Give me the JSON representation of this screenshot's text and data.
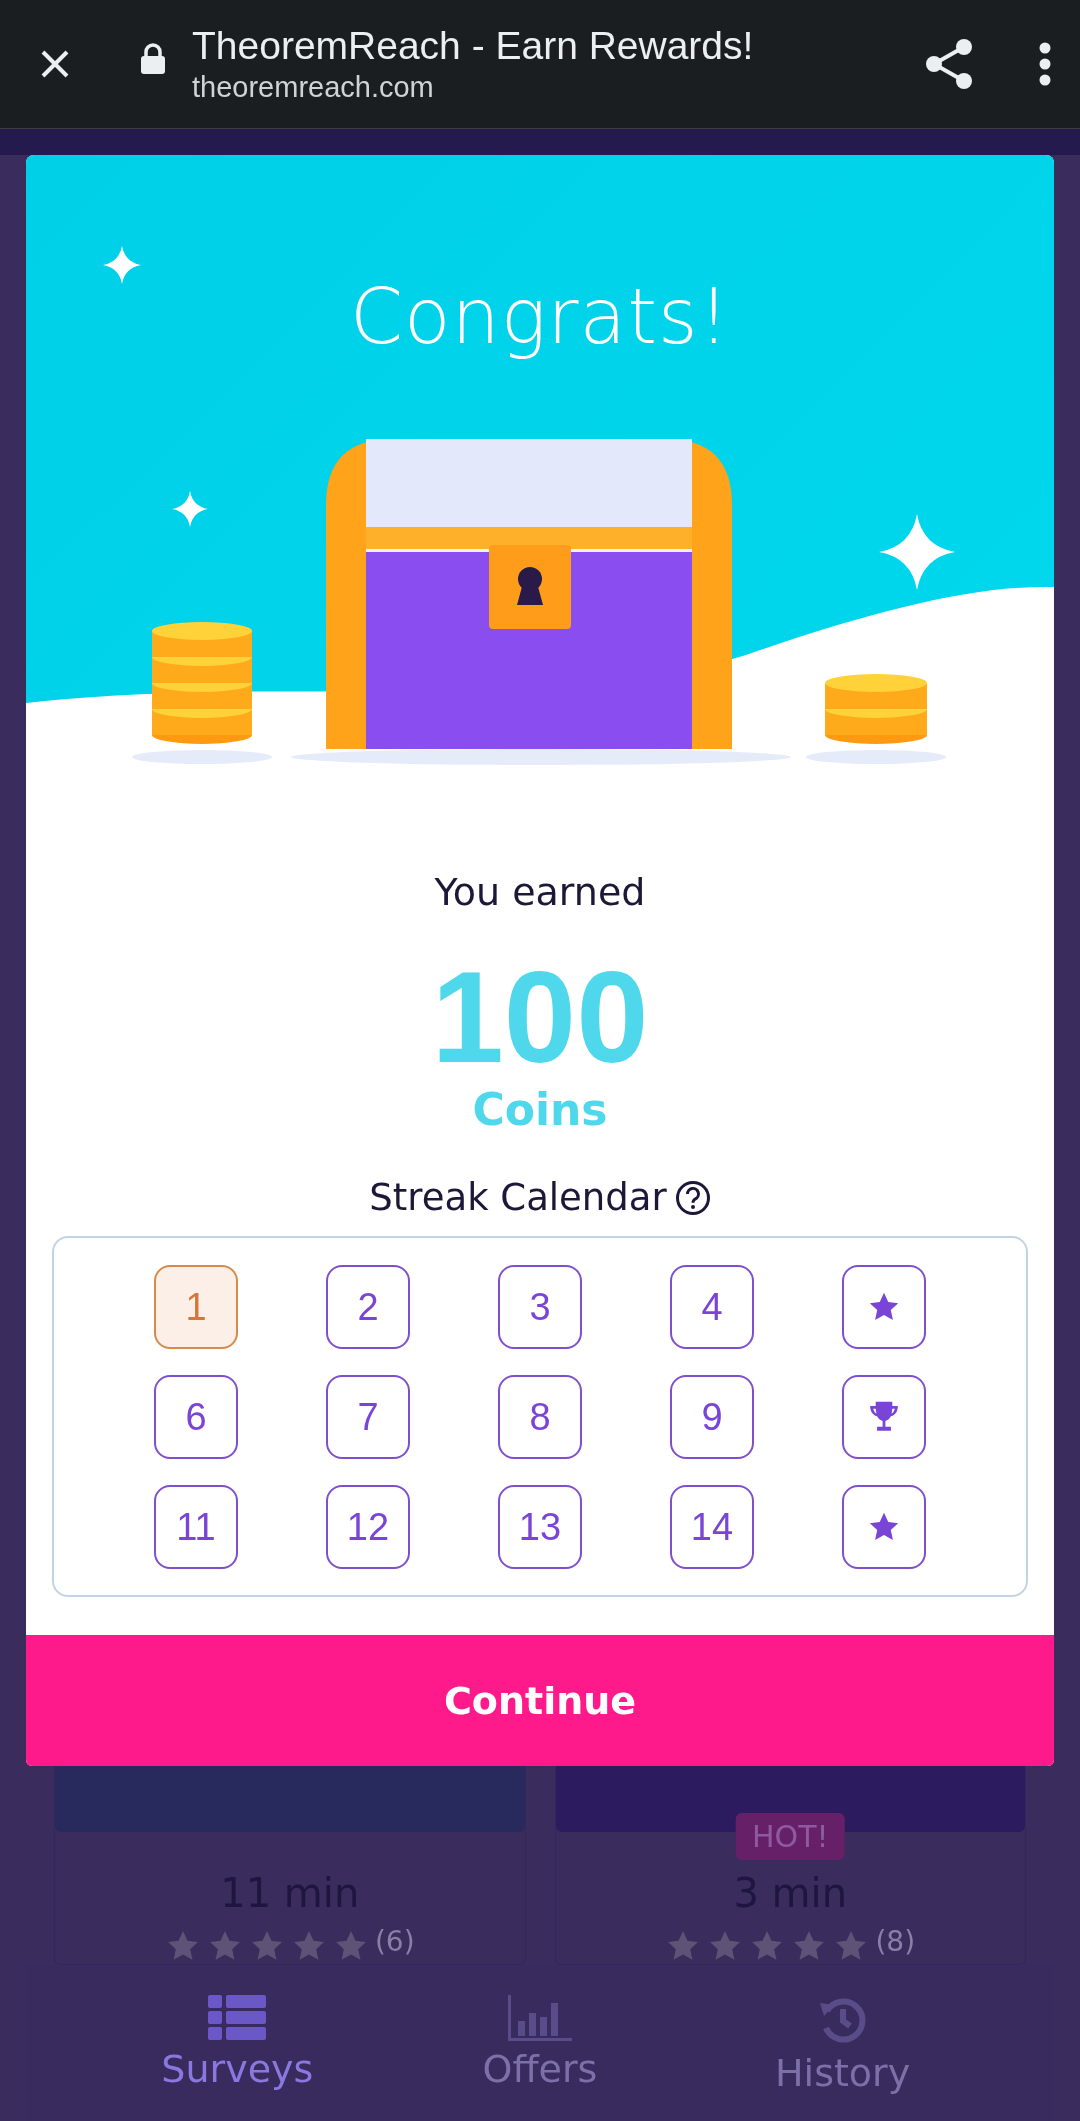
{
  "browser": {
    "title": "TheoremReach - Earn Rewards!",
    "url": "theoremreach.com"
  },
  "modal": {
    "heading": "Congrats!",
    "earned_label": "You earned",
    "amount": "100",
    "unit": "Coins",
    "calendar_title": "Streak Calendar",
    "days": [
      {
        "kind": "number",
        "label": "1",
        "selected": true
      },
      {
        "kind": "number",
        "label": "2",
        "selected": false
      },
      {
        "kind": "number",
        "label": "3",
        "selected": false
      },
      {
        "kind": "number",
        "label": "4",
        "selected": false
      },
      {
        "kind": "star",
        "selected": false
      },
      {
        "kind": "number",
        "label": "6",
        "selected": false
      },
      {
        "kind": "number",
        "label": "7",
        "selected": false
      },
      {
        "kind": "number",
        "label": "8",
        "selected": false
      },
      {
        "kind": "number",
        "label": "9",
        "selected": false
      },
      {
        "kind": "trophy",
        "selected": false
      },
      {
        "kind": "number",
        "label": "11",
        "selected": false
      },
      {
        "kind": "number",
        "label": "12",
        "selected": false
      },
      {
        "kind": "number",
        "label": "13",
        "selected": false
      },
      {
        "kind": "number",
        "label": "14",
        "selected": false
      },
      {
        "kind": "star",
        "selected": false
      }
    ],
    "button": "Continue"
  },
  "background": {
    "cards": [
      {
        "color": "#282a5e",
        "duration": "11 min",
        "stars": 5,
        "count": "(6)"
      },
      {
        "color": "#2c1b5e",
        "badge": "HOT!",
        "duration": "3 min",
        "stars": 5,
        "count": "(8)"
      }
    ],
    "nav": [
      {
        "kind": "list",
        "label": "Surveys",
        "selected": true
      },
      {
        "kind": "chart",
        "label": "Offers",
        "selected": false
      },
      {
        "kind": "history",
        "label": "History",
        "selected": false
      }
    ]
  }
}
